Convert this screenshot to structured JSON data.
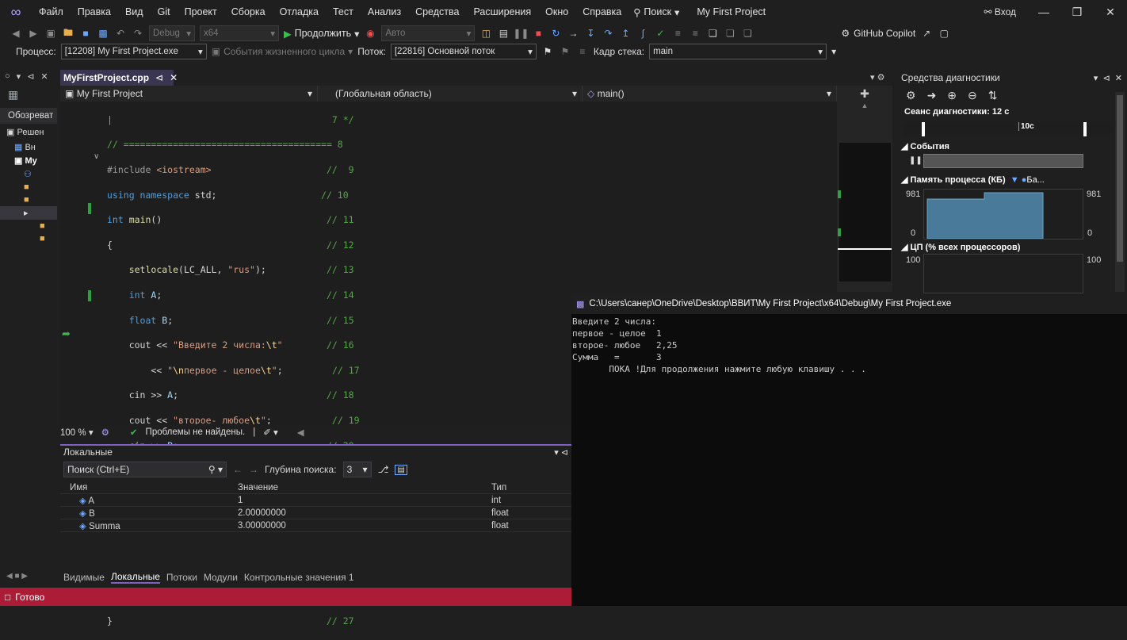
{
  "menu": {
    "items": [
      "Файл",
      "Правка",
      "Вид",
      "Git",
      "Проект",
      "Сборка",
      "Отладка",
      "Тест",
      "Анализ",
      "Средства",
      "Расширения",
      "Окно",
      "Справка"
    ],
    "search_label": "Поиск",
    "project_title": "My First Project",
    "enter_label": "Вход"
  },
  "toolbar": {
    "config": "Debug",
    "platform": "x64",
    "continue_label": "Продолжить",
    "auto_label": "Авто",
    "copilot_label": "GitHub Copilot"
  },
  "debugbar": {
    "process_label": "Процесс:",
    "process_value": "[12208] My First Project.exe",
    "lifecycle_label": "События жизненного цикла",
    "thread_label": "Поток:",
    "thread_value": "[22816] Основной поток",
    "stack_label": "Кадр стека:",
    "stack_value": "main"
  },
  "explorer": {
    "label": "Обозреват",
    "items": [
      "Решен",
      "Вн",
      "My"
    ]
  },
  "editor": {
    "tab_title": "MyFirstProject.cpp",
    "nav_project": "My First Project",
    "nav_scope": "(Глобальная область)",
    "nav_function": "main()",
    "zoom": "100 %",
    "problems": "Проблемы не найдены."
  },
  "diagnostics": {
    "title": "Средства диагностики",
    "session": "Сеанс диагностики: 12 с",
    "timeline_tick": "10с",
    "events_label": "События",
    "memory_label": "Память процесса (КБ)",
    "memory_legend": "Ба...",
    "memory_max": "981",
    "memory_min": "0",
    "cpu_label": "ЦП (% всех процессоров)",
    "cpu_max": "100"
  },
  "console": {
    "path": "C:\\Users\\санер\\OneDrive\\Desktop\\ВВИТ\\My First Project\\x64\\Debug\\My First Project.exe",
    "lines": [
      "Введите 2 числа:",
      "первое - целое  1",
      "второе- любое   2,25",
      "Сумма   =       3",
      "       ПОКА !Для продолжения нажмите любую клавишу . . ."
    ]
  },
  "locals": {
    "title": "Локальные",
    "search_placeholder": "Поиск (Ctrl+E)",
    "depth_label": "Глубина поиска:",
    "depth_value": "3",
    "columns": [
      "Имя",
      "Значение",
      "Тип"
    ],
    "rows": [
      {
        "name": "A",
        "value": "1",
        "type": "int"
      },
      {
        "name": "B",
        "value": "2.00000000",
        "type": "float"
      },
      {
        "name": "Summa",
        "value": "3.00000000",
        "type": "float"
      }
    ]
  },
  "bottom_tabs": [
    "Видимые",
    "Локальные",
    "Потоки",
    "Модули",
    "Контрольные значения 1"
  ],
  "status": "Готово",
  "colors": {
    "status_bar": "#ad1c37",
    "accent": "#8060c0"
  }
}
